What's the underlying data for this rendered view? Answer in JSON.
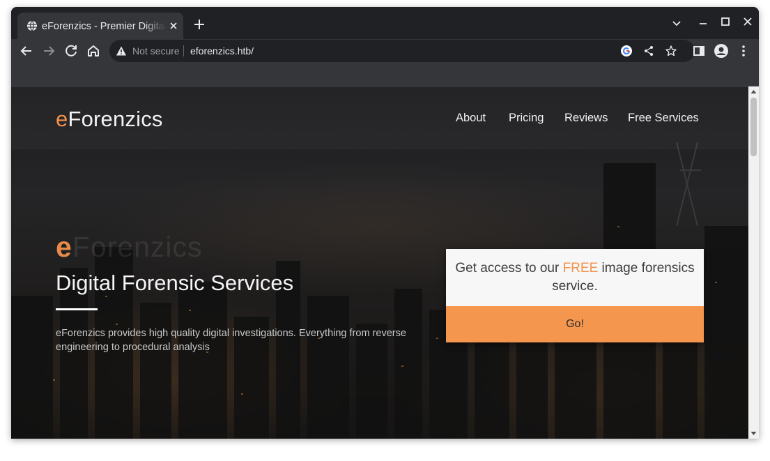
{
  "browser": {
    "tab": {
      "title": "eForenzics - Premier Digital Forensics"
    },
    "omnibox": {
      "security_label": "Not secure",
      "url": "eforenzics.htb/"
    }
  },
  "site": {
    "logo_accent": "e",
    "logo_rest": "Forenzics",
    "nav": [
      "About",
      "Pricing",
      "Reviews",
      "Free Services"
    ],
    "hero": {
      "big_accent": "e",
      "big_rest": "Forenzics",
      "title": "Digital Forensic Services",
      "description": "eForenzics provides high quality digital investigations. Everything from reverse engineering to procedural analysis"
    },
    "cta": {
      "text_before": "Get access to our ",
      "text_highlight": "FREE",
      "text_after": " image forensics service.",
      "button_label": "Go!"
    }
  },
  "colors": {
    "accent": "#f4924c",
    "button": "#f5964f",
    "chrome_dark": "#202124",
    "chrome_toolbar": "#35363a"
  }
}
